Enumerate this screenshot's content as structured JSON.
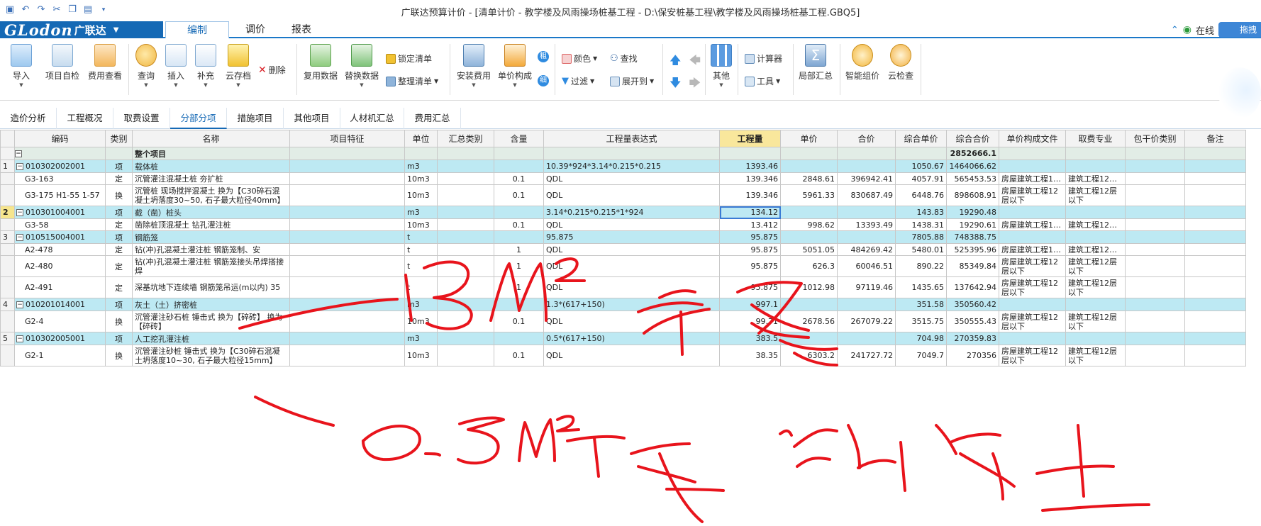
{
  "window": {
    "title": "广联达预算计价 - [清单计价 - 教学楼及风雨操场桩基工程 - D:\\保安桩基工程\\教学楼及风雨操场桩基工程.GBQ5]"
  },
  "logo": {
    "brand": "GLodon",
    "cn": "广联达"
  },
  "menu": {
    "tabs": [
      "编制",
      "调价",
      "报表"
    ],
    "online_label": "在线",
    "drag_label": "拖拽"
  },
  "ribbon": {
    "import": "导入",
    "self_check": "项目自检",
    "fee_view": "费用查看",
    "query": "查询",
    "insert": "插入",
    "supplement": "补充",
    "cloud_save": "云存档",
    "delete": "删除",
    "reuse_data": "复用数据",
    "replace_data": "替换数据",
    "lock_list": "锁定清单",
    "organize_list": "整理清单",
    "install_fee": "安装费用",
    "price_composition": "单价构成",
    "color": "颜色",
    "find": "查找",
    "filter": "过滤",
    "expand_to": "展开到",
    "other": "其他",
    "calculator": "计算器",
    "tools": "工具",
    "partial_summary": "局部汇总",
    "smart_price": "智能组价",
    "cloud_check": "云检查",
    "badge_cu": "粗",
    "badge_xi": "细"
  },
  "view_tabs": [
    "造价分析",
    "工程概况",
    "取费设置",
    "分部分项",
    "措施项目",
    "其他项目",
    "人材机汇总",
    "费用汇总"
  ],
  "grid": {
    "headers": [
      "编码",
      "类别",
      "名称",
      "项目特征",
      "单位",
      "汇总类别",
      "含量",
      "工程量表达式",
      "工程量",
      "单价",
      "合价",
      "综合单价",
      "综合合价",
      "单价构成文件",
      "取费专业",
      "包干价类别",
      "备注"
    ],
    "rows": [
      {
        "kind": "root",
        "rn": "",
        "code": "",
        "type": "",
        "name": "整个项目",
        "feature": "",
        "unit": "",
        "sumcat": "",
        "content": "",
        "expr": "",
        "qty": "",
        "price": "",
        "total": "",
        "uprice": "",
        "utotal": "2852666.1",
        "file": "",
        "major": ""
      },
      {
        "kind": "qd",
        "rn": "1",
        "code": "010302002001",
        "type": "项",
        "name": "载体桩",
        "feature": "",
        "unit": "m3",
        "sumcat": "",
        "content": "",
        "expr": "10.39*924*3.14*0.215*0.215",
        "qty": "1393.46",
        "price": "",
        "total": "",
        "uprice": "1050.67",
        "utotal": "1464066.62",
        "file": "",
        "major": ""
      },
      {
        "kind": "de",
        "rn": "",
        "code": "G3-163",
        "type": "定",
        "name": "沉管灌注混凝土桩 夯扩桩",
        "feature": "",
        "unit": "10m3",
        "sumcat": "",
        "content": "0.1",
        "expr": "QDL",
        "qty": "139.346",
        "price": "2848.61",
        "total": "396942.41",
        "uprice": "4057.91",
        "utotal": "565453.53",
        "file": "房屋建筑工程1…",
        "major": "建筑工程12…"
      },
      {
        "kind": "de",
        "rn": "",
        "code": "G3-175 H1-55 1-57",
        "type": "换",
        "name": "沉管桩 现场搅拌混凝土 换为【C30碎石混凝土坍落度30~50, 石子最大粒径40mm】",
        "feature": "",
        "unit": "10m3",
        "sumcat": "",
        "content": "0.1",
        "expr": "QDL",
        "qty": "139.346",
        "price": "5961.33",
        "total": "830687.49",
        "uprice": "6448.76",
        "utotal": "898608.91",
        "file": "房屋建筑工程12层以下",
        "major": "建筑工程12层以下"
      },
      {
        "kind": "qd",
        "rn": "2",
        "code": "010301004001",
        "type": "项",
        "name": "截（凿）桩头",
        "feature": "",
        "unit": "m3",
        "sumcat": "",
        "content": "",
        "expr": "3.14*0.215*0.215*1*924",
        "qty": "134.12",
        "price": "",
        "total": "",
        "uprice": "143.83",
        "utotal": "19290.48",
        "file": "",
        "major": "",
        "selected": true
      },
      {
        "kind": "de",
        "rn": "",
        "code": "G3-58",
        "type": "定",
        "name": "凿除桩顶混凝土 钻孔灌注桩",
        "feature": "",
        "unit": "10m3",
        "sumcat": "",
        "content": "0.1",
        "expr": "QDL",
        "qty": "13.412",
        "price": "998.62",
        "total": "13393.49",
        "uprice": "1438.31",
        "utotal": "19290.61",
        "file": "房屋建筑工程1…",
        "major": "建筑工程12…"
      },
      {
        "kind": "qd",
        "rn": "3",
        "code": "010515004001",
        "type": "项",
        "name": "钢筋笼",
        "feature": "",
        "unit": "t",
        "sumcat": "",
        "content": "",
        "expr": "95.875",
        "qty": "95.875",
        "price": "",
        "total": "",
        "uprice": "7805.88",
        "utotal": "748388.75",
        "file": "",
        "major": ""
      },
      {
        "kind": "de",
        "rn": "",
        "code": "A2-478",
        "type": "定",
        "name": "钻(冲)孔混凝土灌注桩 钢筋笼制、安",
        "feature": "",
        "unit": "t",
        "sumcat": "",
        "content": "1",
        "expr": "QDL",
        "qty": "95.875",
        "price": "5051.05",
        "total": "484269.42",
        "uprice": "5480.01",
        "utotal": "525395.96",
        "file": "房屋建筑工程1…",
        "major": "建筑工程12…"
      },
      {
        "kind": "de",
        "rn": "",
        "code": "A2-480",
        "type": "定",
        "name": "钻(冲)孔混凝土灌注桩 钢筋笼接头吊焊搭接焊",
        "feature": "",
        "unit": "t",
        "sumcat": "",
        "content": "1",
        "expr": "QDL",
        "qty": "95.875",
        "price": "626.3",
        "total": "60046.51",
        "uprice": "890.22",
        "utotal": "85349.84",
        "file": "房屋建筑工程12层以下",
        "major": "建筑工程12层以下"
      },
      {
        "kind": "de",
        "rn": "",
        "code": "A2-491",
        "type": "定",
        "name": "深基坑地下连续墙 钢筋笼吊运(m以内) 35",
        "feature": "",
        "unit": "t",
        "sumcat": "",
        "content": "1",
        "expr": "QDL",
        "qty": "95.875",
        "price": "1012.98",
        "total": "97119.46",
        "uprice": "1435.65",
        "utotal": "137642.94",
        "file": "房屋建筑工程12层以下",
        "major": "建筑工程12层以下"
      },
      {
        "kind": "qd",
        "rn": "4",
        "code": "010201014001",
        "type": "项",
        "name": "灰土（土）挤密桩",
        "feature": "",
        "unit": "m3",
        "sumcat": "",
        "content": "",
        "expr": "1.3*(617+150)",
        "qty": "997.1",
        "price": "",
        "total": "",
        "uprice": "351.58",
        "utotal": "350560.42",
        "file": "",
        "major": ""
      },
      {
        "kind": "de",
        "rn": "",
        "code": "G2-4",
        "type": "换",
        "name": "沉管灌注砂石桩 锤击式 换为【碎砖】 换为【碎砖】",
        "feature": "",
        "unit": "10m3",
        "sumcat": "",
        "content": "0.1",
        "expr": "QDL",
        "qty": "99.71",
        "price": "2678.56",
        "total": "267079.22",
        "uprice": "3515.75",
        "utotal": "350555.43",
        "file": "房屋建筑工程12层以下",
        "major": "建筑工程12层以下"
      },
      {
        "kind": "qd",
        "rn": "5",
        "code": "010302005001",
        "type": "项",
        "name": "人工挖孔灌注桩",
        "feature": "",
        "unit": "m3",
        "sumcat": "",
        "content": "",
        "expr": "0.5*(617+150)",
        "qty": "383.5",
        "price": "",
        "total": "",
        "uprice": "704.98",
        "utotal": "270359.83",
        "file": "",
        "major": ""
      },
      {
        "kind": "de",
        "rn": "",
        "code": "G2-1",
        "type": "换",
        "name": "沉管灌注砂桩 锤击式 换为【C30碎石混凝土坍落度10~30, 石子最大粒径15mm】",
        "feature": "",
        "unit": "10m3",
        "sumcat": "",
        "content": "0.1",
        "expr": "QDL",
        "qty": "38.35",
        "price": "6303.2",
        "total": "241727.72",
        "uprice": "7049.7",
        "utotal": "270356",
        "file": "房屋建筑工程12层以下",
        "major": "建筑工程12层以下"
      }
    ]
  },
  "colors": {
    "brand": "#1569b5",
    "qd_row": "#bde9f3",
    "root_row": "#e2ede6",
    "ink": "#e8141c",
    "highlight": "#f9e79c"
  }
}
